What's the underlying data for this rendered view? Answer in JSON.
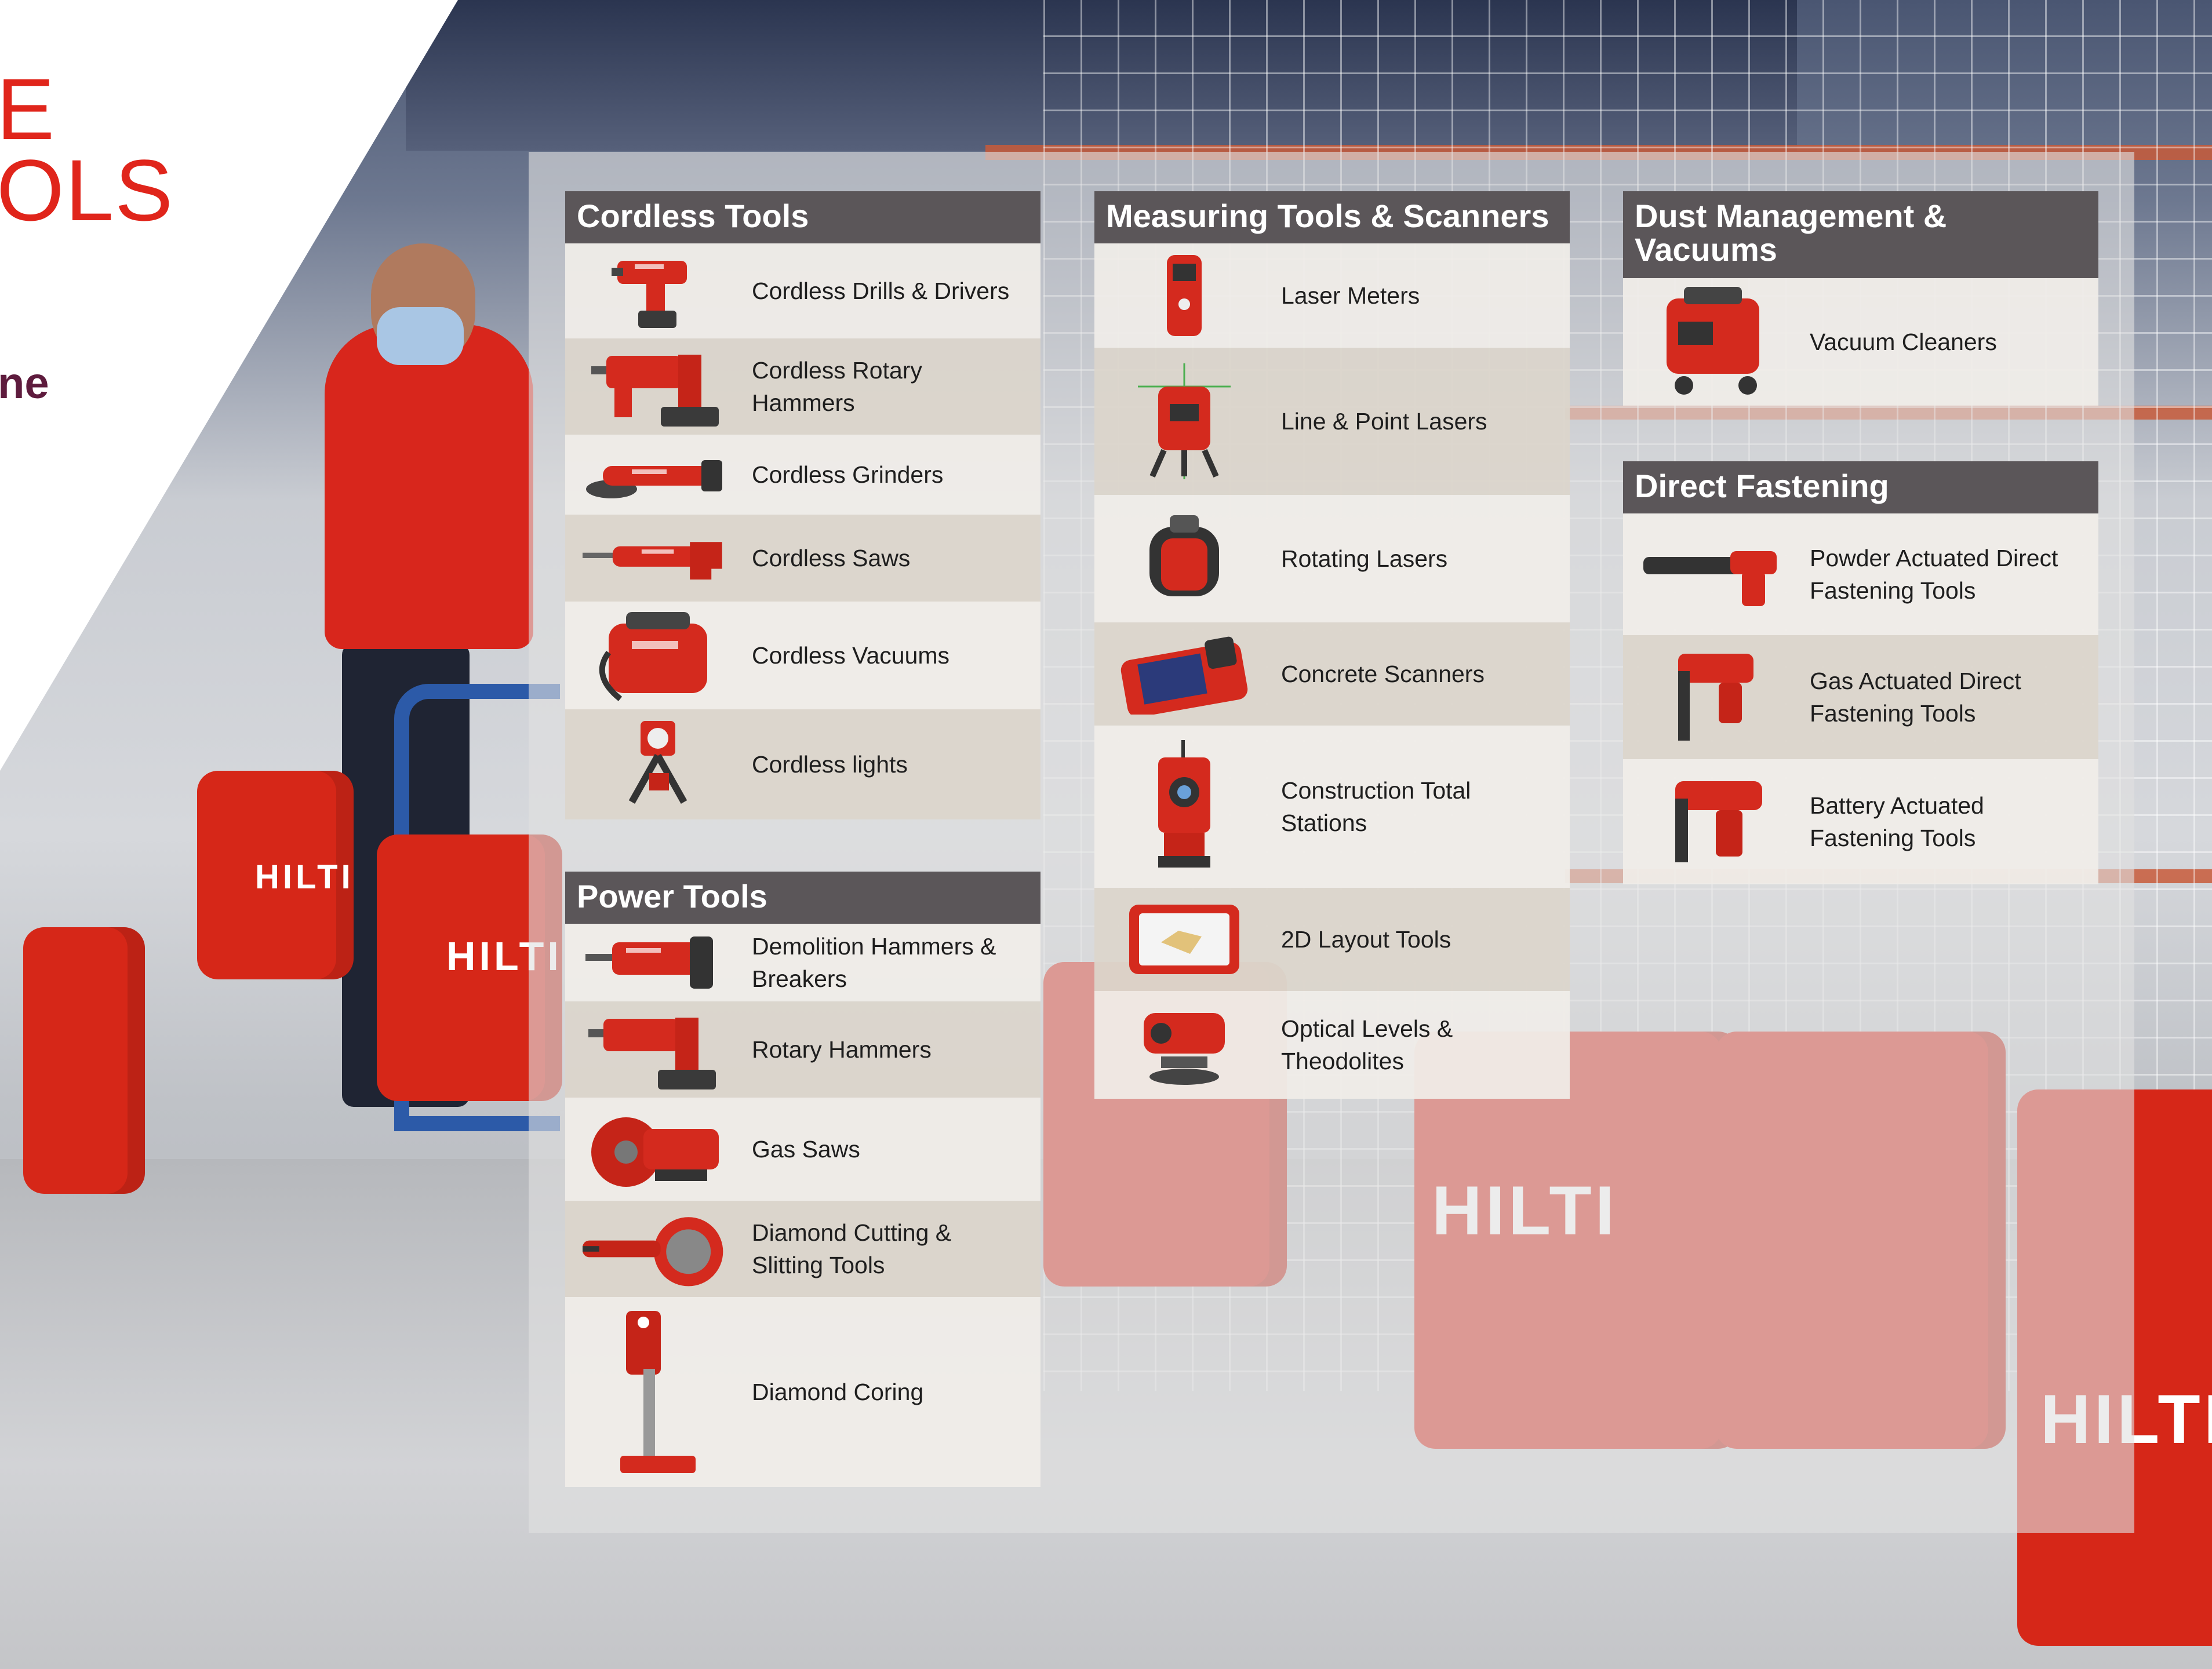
{
  "brand": {
    "logo_text": "HILTI"
  },
  "hero": {
    "title_line1": "E",
    "title_line2": "OLS",
    "subtitle": "ne"
  },
  "sections": {
    "cordless": {
      "title": "Cordless Tools",
      "items": [
        {
          "label": "Cordless Drills & Drivers",
          "icon": "drill-icon"
        },
        {
          "label": "Cordless Rotary Hammers",
          "icon": "rotary-hammer-icon"
        },
        {
          "label": "Cordless Grinders",
          "icon": "grinder-icon"
        },
        {
          "label": "Cordless Saws",
          "icon": "saw-icon"
        },
        {
          "label": "Cordless Vacuums",
          "icon": "vacuum-icon"
        },
        {
          "label": "Cordless lights",
          "icon": "light-icon"
        }
      ]
    },
    "power": {
      "title": "Power Tools",
      "items": [
        {
          "label": "Demolition Hammers & Breakers",
          "icon": "demolition-hammer-icon"
        },
        {
          "label": "Rotary Hammers",
          "icon": "rotary-hammer-icon"
        },
        {
          "label": "Gas Saws",
          "icon": "gas-saw-icon"
        },
        {
          "label": "Diamond Cutting & Slitting Tools",
          "icon": "diamond-cutter-icon"
        },
        {
          "label": "Diamond Coring",
          "icon": "coring-rig-icon"
        }
      ]
    },
    "measuring": {
      "title": "Measuring Tools & Scanners",
      "items": [
        {
          "label": "Laser Meters",
          "icon": "laser-meter-icon"
        },
        {
          "label": "Line & Point Lasers",
          "icon": "line-laser-icon"
        },
        {
          "label": "Rotating Lasers",
          "icon": "rotating-laser-icon"
        },
        {
          "label": "Concrete Scanners",
          "icon": "concrete-scanner-icon"
        },
        {
          "label": "Construction Total Stations",
          "icon": "total-station-icon"
        },
        {
          "label": "2D Layout Tools",
          "icon": "tablet-icon"
        },
        {
          "label": "Optical Levels & Theodolites",
          "icon": "optical-level-icon"
        }
      ]
    },
    "dust": {
      "title": "Dust Management & Vacuums",
      "items": [
        {
          "label": "Vacuum Cleaners",
          "icon": "vacuum-cleaner-icon"
        }
      ]
    },
    "fastening": {
      "title": "Direct Fastening",
      "items": [
        {
          "label": "Powder Actuated Direct Fastening Tools",
          "icon": "powder-tool-icon"
        },
        {
          "label": "Gas Actuated Direct Fastening Tools",
          "icon": "gas-nailer-icon"
        },
        {
          "label": "Battery Actuated Fastening Tools",
          "icon": "battery-nailer-icon"
        }
      ]
    }
  },
  "colors": {
    "accent": "#e0251b",
    "header": "#5b5659",
    "subtitle": "#5e1b3d"
  }
}
